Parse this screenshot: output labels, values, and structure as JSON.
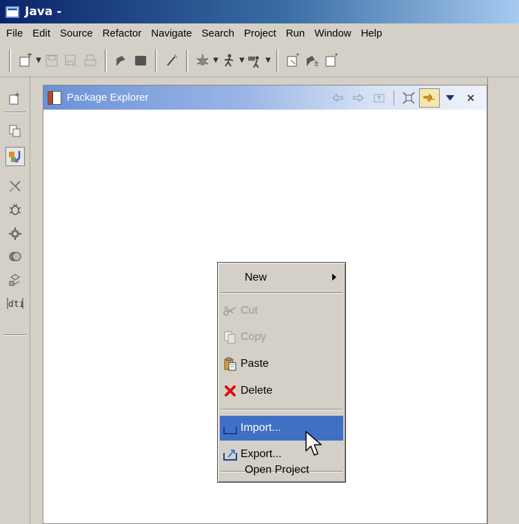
{
  "window": {
    "title": "Java -"
  },
  "menubar": {
    "items": [
      "File",
      "Edit",
      "Source",
      "Refactor",
      "Navigate",
      "Search",
      "Project",
      "Run",
      "Window",
      "Help"
    ]
  },
  "toolbar": {
    "buttons": [
      "new-wizard",
      "save",
      "save-all",
      "print",
      "open-type",
      "new-java",
      "debug",
      "run",
      "external-tools",
      "open-perspective"
    ]
  },
  "package_explorer": {
    "title": "Package Explorer",
    "icons": [
      "back-icon",
      "forward-icon",
      "up-icon",
      "collapse-all-icon",
      "link-with-editor-icon",
      "view-menu-icon",
      "close-icon"
    ]
  },
  "context_menu": {
    "new_label": "New",
    "cut_label": "Cut",
    "copy_label": "Copy",
    "paste_label": "Paste",
    "delete_label": "Delete",
    "import_label": "Import...",
    "export_label": "Export...",
    "open_project_label": "Open Project"
  },
  "colors": {
    "highlight": "#3f70c4",
    "title_bar": "#0a246a",
    "view_header": "#6b91d6"
  }
}
